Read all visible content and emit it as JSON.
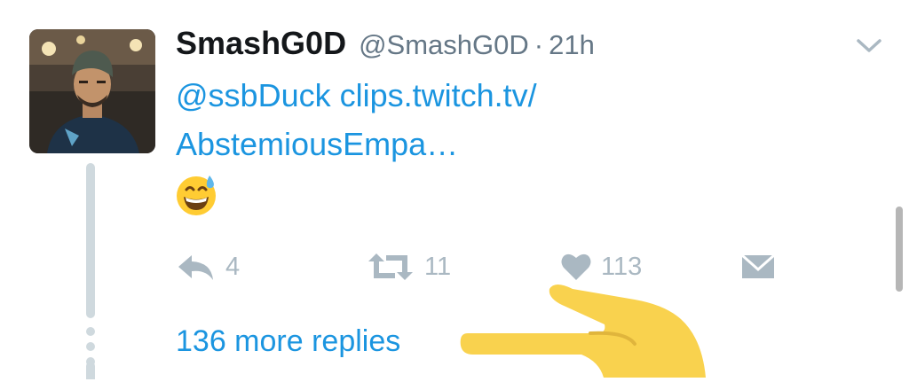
{
  "tweet": {
    "display_name": "SmashG0D",
    "handle": "@SmashG0D",
    "separator": "·",
    "time": "21h",
    "text_lines": [
      "@ssbDuck clips.twitch.tv/",
      "AbstemiousEmpa…"
    ],
    "emoji": "grinning-face-with-sweat-emoji",
    "actions": {
      "reply_count": "4",
      "retweet_count": "11",
      "like_count": "113"
    },
    "more_replies": "136 more replies"
  },
  "colors": {
    "link": "#1b95e0",
    "muted": "#657786",
    "icon": "#aab8c2",
    "thread": "#cfd9de",
    "pointer_hand": "#f9d24e"
  },
  "icons": [
    "chevron-down-icon",
    "reply-icon",
    "retweet-icon",
    "heart-icon",
    "envelope-icon",
    "pointing-hand-emoji"
  ]
}
